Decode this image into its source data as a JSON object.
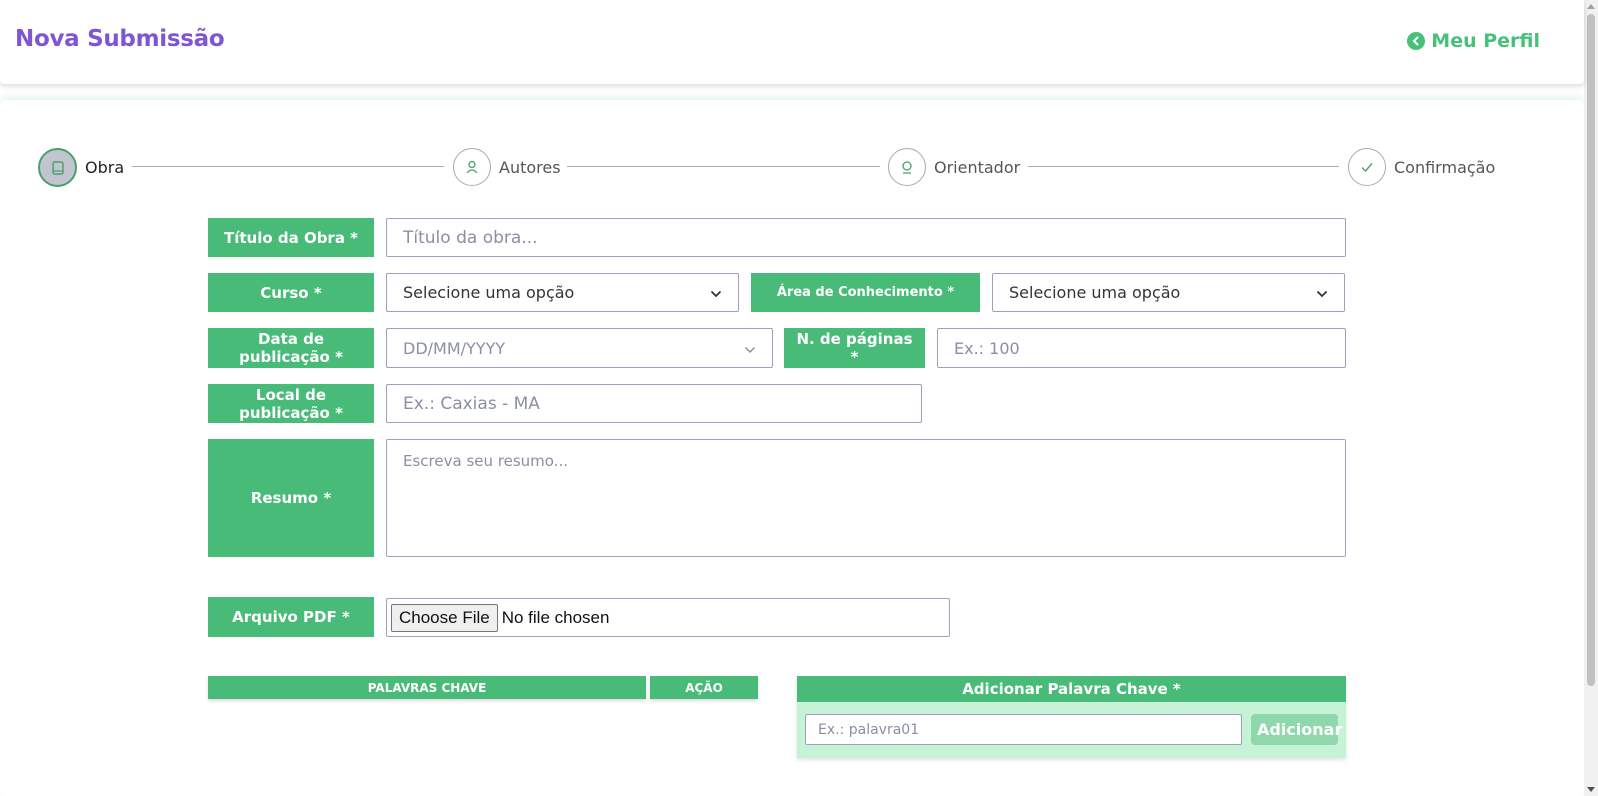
{
  "header": {
    "title": "Nova Submissão",
    "profile_link": "Meu Perfil"
  },
  "stepper": {
    "steps": [
      {
        "label": "Obra",
        "icon": "book-icon",
        "active": true
      },
      {
        "label": "Autores",
        "icon": "user-icon",
        "active": false
      },
      {
        "label": "Orientador",
        "icon": "advisor-icon",
        "active": false
      },
      {
        "label": "Confirmação",
        "icon": "check-icon",
        "active": false
      }
    ]
  },
  "form": {
    "titulo": {
      "label": "Título da Obra *",
      "placeholder": "Título da obra...",
      "value": ""
    },
    "curso": {
      "label": "Curso *",
      "value": "Selecione uma opção"
    },
    "area": {
      "label": "Área de Conhecimento *",
      "value": "Selecione uma opção"
    },
    "data": {
      "label": "Data de publicação *",
      "placeholder": "DD/MM/YYYY"
    },
    "paginas": {
      "label": "N. de páginas *",
      "placeholder": "Ex.: 100",
      "value": ""
    },
    "local": {
      "label": "Local de publicação *",
      "placeholder": "Ex.: Caxias - MA",
      "value": ""
    },
    "resumo": {
      "label": "Resumo *",
      "placeholder": "Escreva seu resumo...",
      "value": ""
    },
    "arquivo": {
      "label": "Arquivo PDF *",
      "button": "Choose File",
      "status": "No file chosen"
    }
  },
  "keywords_table": {
    "columns": [
      "PALAVRAS CHAVE",
      "AÇÃO"
    ],
    "rows": []
  },
  "add_keyword": {
    "title": "Adicionar Palavra Chave *",
    "placeholder": "Ex.: palavra01",
    "button": "Adicionar"
  },
  "colors": {
    "primary_green": "#48bb78",
    "title_purple": "#7f55d4",
    "disabled_green": "#8fd8ac"
  }
}
